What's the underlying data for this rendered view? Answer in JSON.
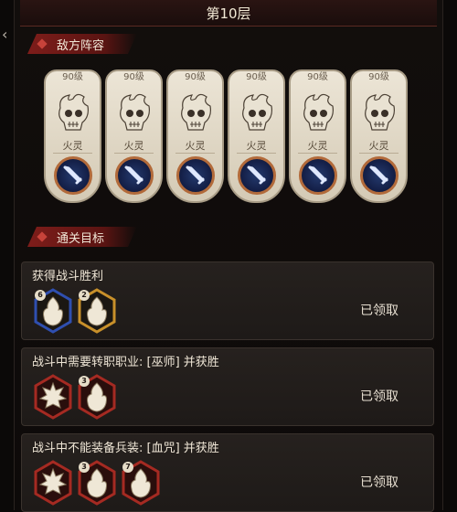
{
  "header": {
    "title": "第10层"
  },
  "enemy_section": {
    "label": "敌方阵容"
  },
  "enemies": [
    {
      "level": "90级",
      "name": "火灵",
      "portrait": "fire-spirit-skull-icon",
      "class_icon": "sword-icon"
    },
    {
      "level": "90级",
      "name": "火灵",
      "portrait": "fire-spirit-skull-icon",
      "class_icon": "sword-icon"
    },
    {
      "level": "90级",
      "name": "火灵",
      "portrait": "fire-spirit-skull-icon",
      "class_icon": "sword-icon"
    },
    {
      "level": "90级",
      "name": "火灵",
      "portrait": "fire-spirit-skull-icon",
      "class_icon": "sword-icon"
    },
    {
      "level": "90级",
      "name": "火灵",
      "portrait": "fire-spirit-skull-icon",
      "class_icon": "sword-icon"
    },
    {
      "level": "90级",
      "name": "火灵",
      "portrait": "fire-spirit-skull-icon",
      "class_icon": "sword-icon"
    }
  ],
  "goals_section": {
    "label": "通关目标"
  },
  "objectives": [
    {
      "title": "获得战斗胜利",
      "status": "已领取",
      "rewards": [
        {
          "icon": "flame-icon",
          "frame": "blue",
          "badge": "6"
        },
        {
          "icon": "flame-icon",
          "frame": "gold",
          "badge": "2"
        }
      ]
    },
    {
      "title": "战斗中需要转职职业: [巫师] 并获胜",
      "status": "已领取",
      "rewards": [
        {
          "icon": "sunburst-icon",
          "frame": "red",
          "badge": ""
        },
        {
          "icon": "flame-icon",
          "frame": "red",
          "badge": "3"
        }
      ]
    },
    {
      "title": "战斗中不能装备兵装: [血咒] 并获胜",
      "status": "已领取",
      "rewards": [
        {
          "icon": "sunburst-icon",
          "frame": "red",
          "badge": ""
        },
        {
          "icon": "flame-icon",
          "frame": "red",
          "badge": "3"
        },
        {
          "icon": "flame-icon",
          "frame": "red",
          "badge": "7"
        }
      ]
    }
  ],
  "colors": {
    "ribbon": "#7e1d1a",
    "frame_red": "#a52a22",
    "frame_blue": "#2f4fb0",
    "frame_gold": "#c8902a"
  }
}
